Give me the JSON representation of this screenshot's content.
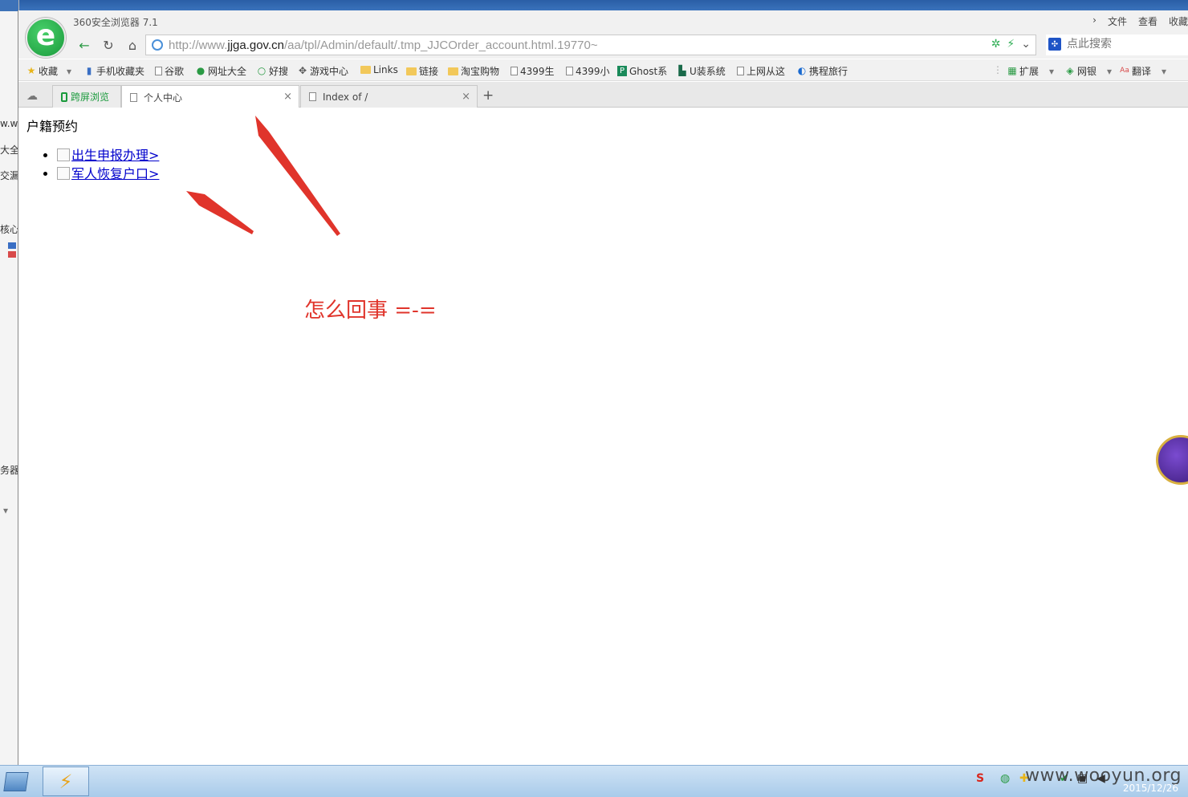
{
  "window": {
    "app_title": "360安全浏览器 7.1",
    "menu": [
      "文件",
      "查看",
      "收藏"
    ]
  },
  "address_bar": {
    "url_prefix": "http://www.",
    "url_host": "jjga.gov.cn",
    "url_path": "/aa/tpl/Admin/default/.tmp_JJCOrder_account.html.19770~",
    "search_placeholder": "点此搜索"
  },
  "bookmarks": {
    "left": [
      "收藏",
      "手机收藏夹",
      "谷歌",
      "网址大全",
      "好搜",
      "游戏中心",
      "Links",
      "链接",
      "淘宝购物",
      "4399生",
      "4399小",
      "Ghost系",
      "U装系统",
      "上网从这",
      "携程旅行"
    ],
    "right": [
      "扩展",
      "网银",
      "翻译"
    ]
  },
  "tabs": {
    "split": "跨屏浏览",
    "personal": "个人中心",
    "index": "Index of /",
    "new": "+"
  },
  "content": {
    "heading": "户籍预约",
    "links": [
      "出生申报办理>",
      "军人恢复户口>"
    ],
    "annotation": "怎么回事 =-="
  },
  "background_fragments": [
    "w.w",
    "大全",
    "交漏",
    "核心",
    "务器",
    "▾"
  ],
  "taskbar": {
    "date": "2015/12/26",
    "watermark": "www.wooyun.org"
  },
  "colors": {
    "annotation_red": "#e0342b",
    "brand_green": "#1a9a3c",
    "link_blue": "#0000cc"
  }
}
